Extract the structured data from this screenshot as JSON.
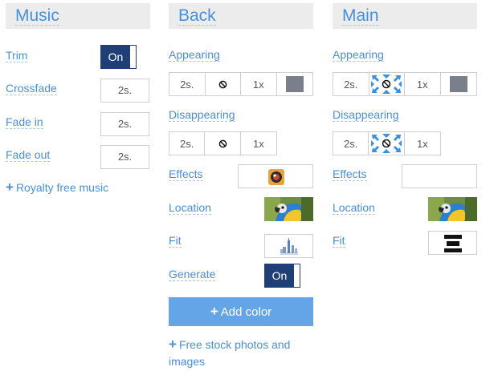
{
  "music": {
    "title": "Music",
    "trim_label": "Trim",
    "trim_toggle": "On",
    "crossfade_label": "Crossfade",
    "crossfade_value": "2s.",
    "fade_in_label": "Fade in",
    "fade_in_value": "2s.",
    "fade_out_label": "Fade out",
    "fade_out_value": "2s.",
    "royalty_link": "Royalty free music"
  },
  "back": {
    "title": "Back",
    "appearing_label": "Appearing",
    "appearing": {
      "duration": "2s.",
      "speed": "1x",
      "effect_icon": "ban-icon",
      "color": "#7a7f8c"
    },
    "disappearing_label": "Disappearing",
    "disappearing": {
      "duration": "2s.",
      "speed": "1x",
      "effect_icon": "ban-icon"
    },
    "effects_label": "Effects",
    "location_label": "Location",
    "fit_label": "Fit",
    "generate_label": "Generate",
    "generate_toggle": "On",
    "add_color_button": "Add color",
    "stock_link": "Free stock photos and images"
  },
  "main": {
    "title": "Main",
    "appearing_label": "Appearing",
    "appearing": {
      "duration": "2s.",
      "speed": "1x",
      "effect_icon": "collapse-arrows-icon",
      "color": "#7a7f8c"
    },
    "disappearing_label": "Disappearing",
    "disappearing": {
      "duration": "2s.",
      "speed": "1x",
      "effect_icon": "collapse-arrows-icon"
    },
    "effects_label": "Effects",
    "location_label": "Location",
    "fit_label": "Fit"
  }
}
